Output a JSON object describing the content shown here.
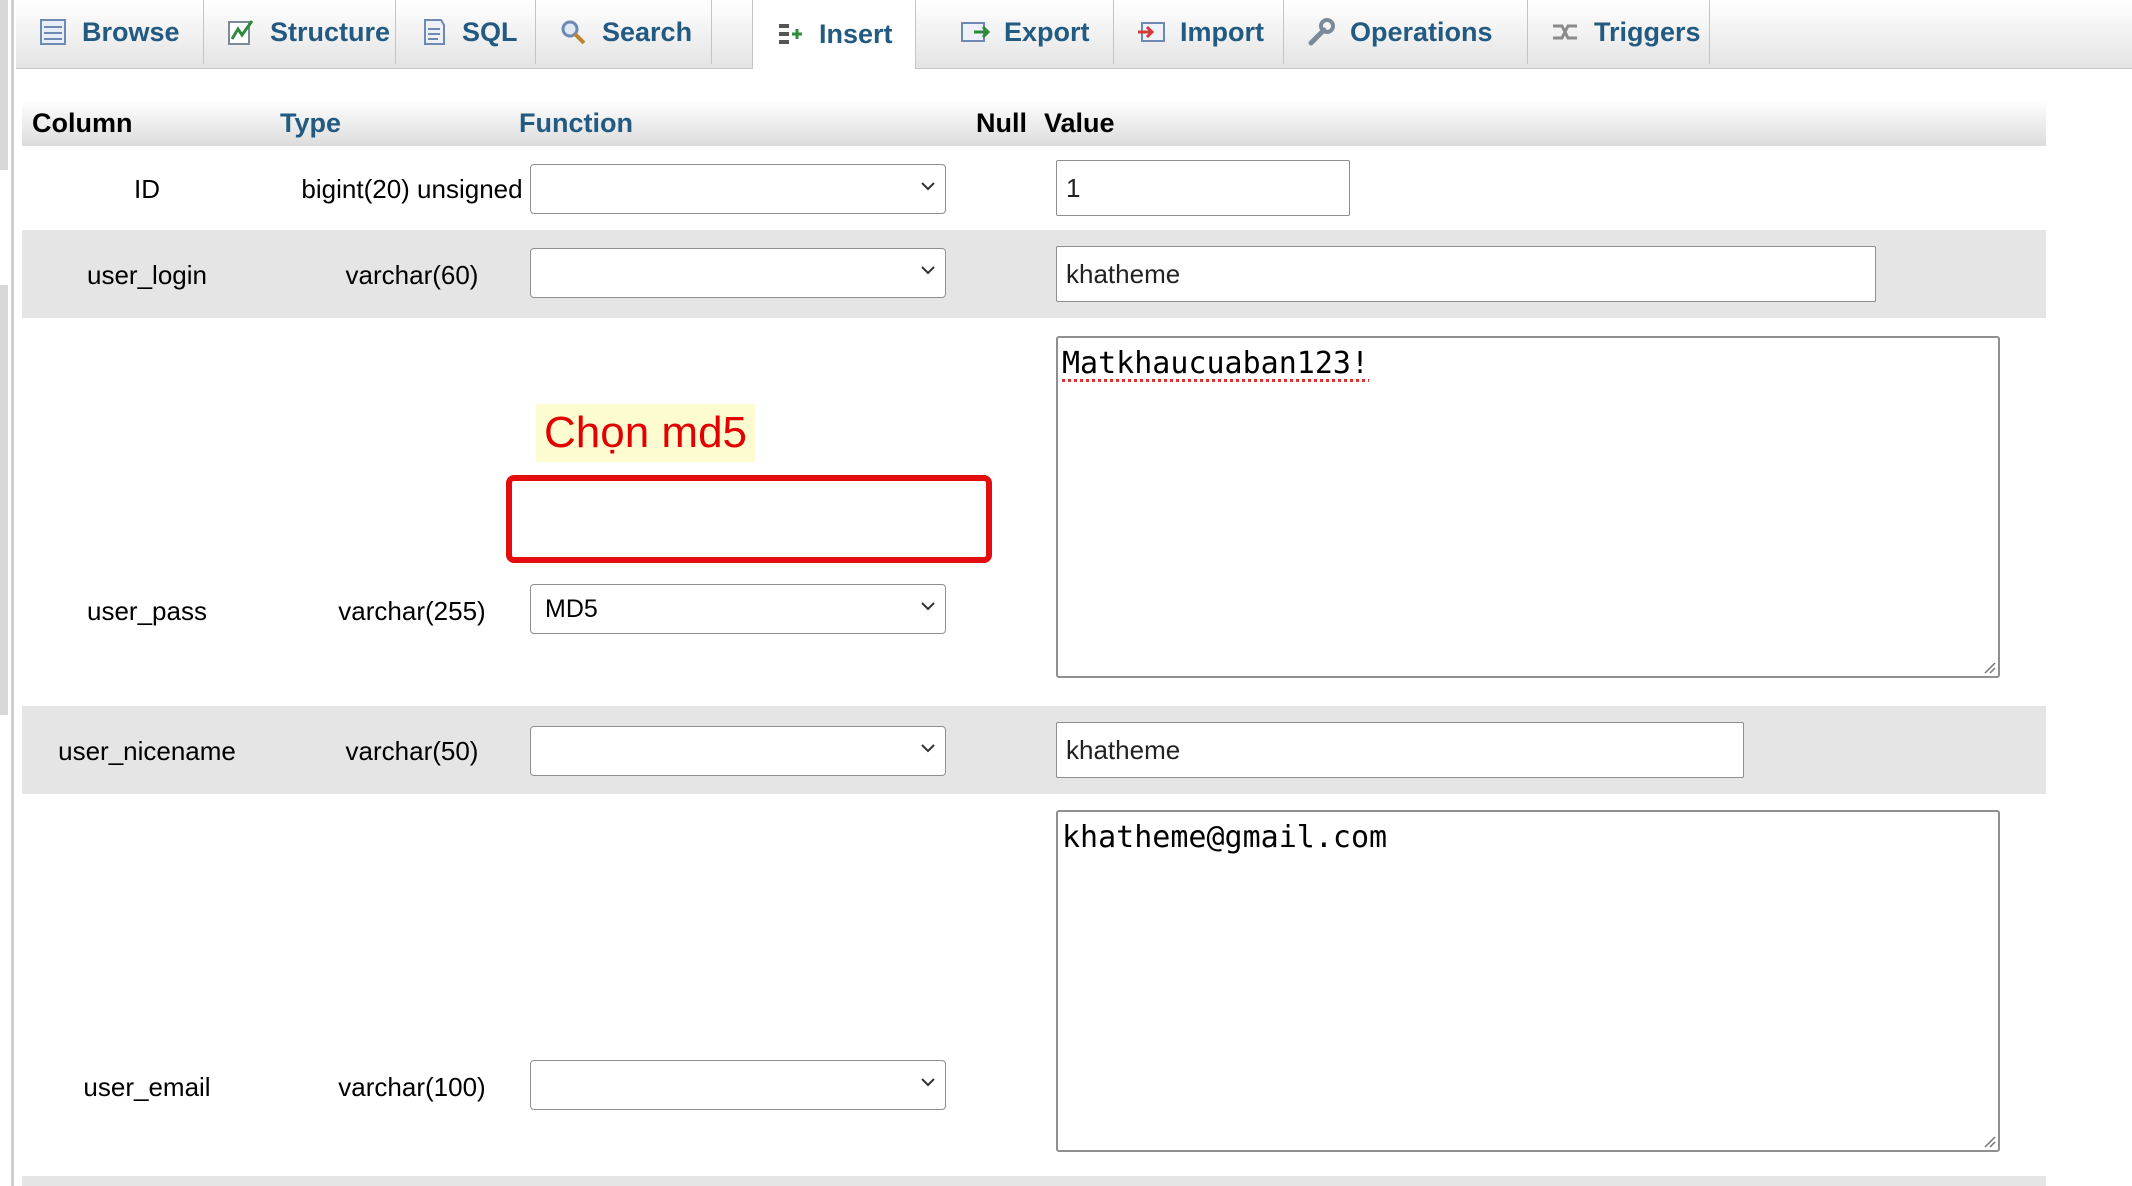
{
  "tabs": [
    {
      "label": "Browse",
      "icon": "browse-icon"
    },
    {
      "label": "Structure",
      "icon": "structure-icon"
    },
    {
      "label": "SQL",
      "icon": "sql-icon"
    },
    {
      "label": "Search",
      "icon": "search-icon"
    },
    {
      "label": "Insert",
      "icon": "insert-icon",
      "active": true
    },
    {
      "label": "Export",
      "icon": "export-icon"
    },
    {
      "label": "Import",
      "icon": "import-icon"
    },
    {
      "label": "Operations",
      "icon": "operations-icon"
    },
    {
      "label": "Triggers",
      "icon": "triggers-icon"
    }
  ],
  "table": {
    "headers": {
      "column": "Column",
      "type": "Type",
      "function": "Function",
      "null": "Null",
      "value": "Value"
    },
    "rows": [
      {
        "column": "ID",
        "type": "bigint(20) unsigned",
        "function": "",
        "value": "1"
      },
      {
        "column": "user_login",
        "type": "varchar(60)",
        "function": "",
        "value": "khatheme"
      },
      {
        "column": "user_pass",
        "type": "varchar(255)",
        "function": "MD5",
        "value": "Matkhaucuaban123!"
      },
      {
        "column": "user_nicename",
        "type": "varchar(50)",
        "function": "",
        "value": "khatheme"
      },
      {
        "column": "user_email",
        "type": "varchar(100)",
        "function": "",
        "value": "khatheme@gmail.com"
      }
    ]
  },
  "annotation": {
    "label": "Chọn md5",
    "color": "#e30000"
  },
  "colors": {
    "link": "#235a81",
    "row_alt": "#e5e5e5"
  }
}
